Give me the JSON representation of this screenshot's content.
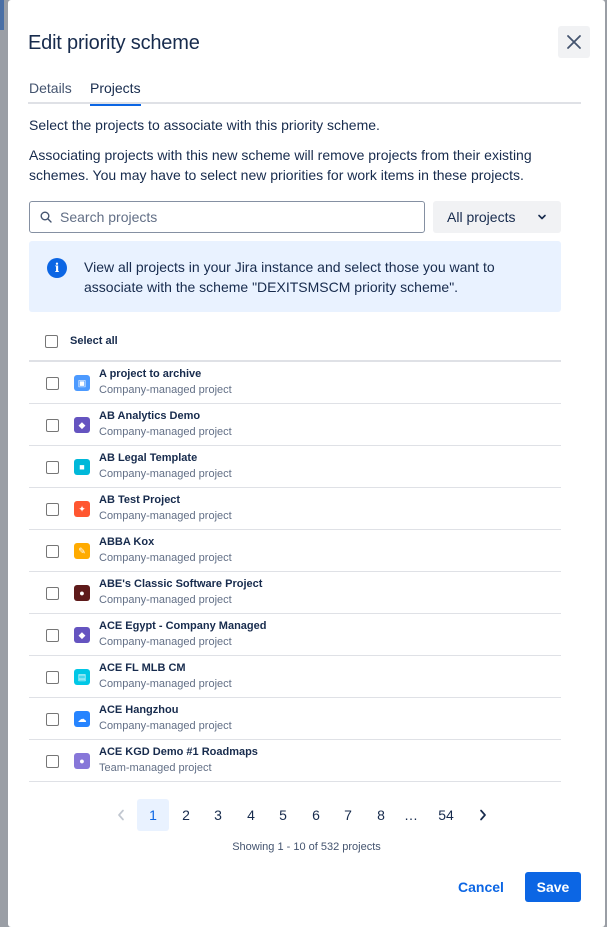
{
  "modal": {
    "title": "Edit priority scheme",
    "tabs": [
      {
        "label": "Details",
        "active": false
      },
      {
        "label": "Projects",
        "active": true
      }
    ],
    "intro": "Select the projects to associate with this priority scheme.",
    "description": "Associating projects with this new scheme will remove projects from their existing schemes. You may have to select new priorities for work items in these projects.",
    "search": {
      "placeholder": "Search projects"
    },
    "filter": {
      "label": "All projects"
    },
    "info": "View all projects in your Jira instance and select those you want to associate with the scheme \"DEXITSMSCM priority scheme\".",
    "select_all_label": "Select all",
    "projects": [
      {
        "name": "A project to archive",
        "type": "Company-managed project",
        "icon": "archive-project-icon",
        "color": "#4c9aff"
      },
      {
        "name": "AB Analytics Demo",
        "type": "Company-managed project",
        "icon": "analytics-project-icon",
        "color": "#6554c0"
      },
      {
        "name": "AB Legal Template",
        "type": "Company-managed project",
        "icon": "legal-project-icon",
        "color": "#00b8d9"
      },
      {
        "name": "AB Test Project",
        "type": "Company-managed project",
        "icon": "test-project-icon",
        "color": "#ff5630"
      },
      {
        "name": "ABBA Kox",
        "type": "Company-managed project",
        "icon": "pencil-project-icon",
        "color": "#ffab00"
      },
      {
        "name": "ABE's Classic Software Project",
        "type": "Company-managed project",
        "icon": "software-project-icon",
        "color": "#5e1a1a"
      },
      {
        "name": "ACE Egypt - Company Managed",
        "type": "Company-managed project",
        "icon": "egypt-project-icon",
        "color": "#6554c0"
      },
      {
        "name": "ACE FL MLB CM",
        "type": "Company-managed project",
        "icon": "notes-project-icon",
        "color": "#00c7e6"
      },
      {
        "name": "ACE Hangzhou",
        "type": "Company-managed project",
        "icon": "cloud-project-icon",
        "color": "#2684ff"
      },
      {
        "name": "ACE KGD Demo #1 Roadmaps",
        "type": "Team-managed project",
        "icon": "roadmaps-project-icon",
        "color": "#8777d9"
      }
    ],
    "pagination": {
      "pages": [
        "1",
        "2",
        "3",
        "4",
        "5",
        "6",
        "7",
        "8",
        "…",
        "54"
      ],
      "current": "1"
    },
    "showing": "Showing 1 - 10 of 532 projects",
    "cancel_label": "Cancel",
    "save_label": "Save"
  },
  "colors": {
    "accent": "#0c66e4",
    "info_bg": "#e9f2ff"
  }
}
